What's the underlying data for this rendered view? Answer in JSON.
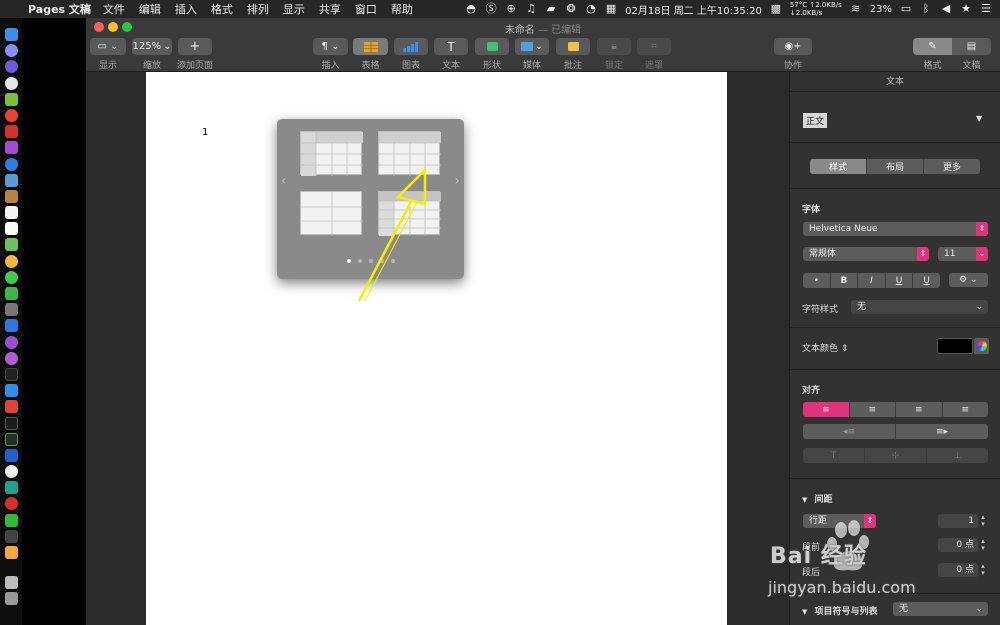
{
  "menubar": {
    "app_name": "Pages 文稿",
    "menus": [
      "文件",
      "编辑",
      "插入",
      "格式",
      "排列",
      "显示",
      "共享",
      "窗口",
      "帮助"
    ],
    "temperature": "57°C",
    "net_up": "↑2.0KB/s",
    "net_down": "↓2.0KB/s",
    "datetime": "02月18日 周二 上午10:35:20",
    "battery": "23%"
  },
  "window": {
    "title": "未命名",
    "title_suffix": "— 已编辑"
  },
  "toolbar": {
    "view_label": "显示",
    "zoom_value": "125%",
    "zoom_label": "缩放",
    "add_page_label": "添加页面",
    "insert_label": "插入",
    "table_label": "表格",
    "chart_label": "图表",
    "text_label": "文本",
    "shape_label": "形状",
    "media_label": "媒体",
    "comment_label": "批注",
    "lock_label": "锁定",
    "mask_label": "遮罩",
    "collab_label": "协作",
    "format_label": "格式",
    "document_label": "文稿"
  },
  "document": {
    "page_number": "1"
  },
  "inspector": {
    "header": "文本",
    "paragraph_style": "正文",
    "tabs": [
      "样式",
      "布局",
      "更多"
    ],
    "font_section": "字体",
    "font_name": "Helvetica Neue",
    "font_style": "常规体",
    "font_size": "11",
    "bullet_btn": "•",
    "bold_btn": "B",
    "italic_btn": "I",
    "underline_btn": "U",
    "strike_btn": "U",
    "gear_btn": "⚙",
    "char_style_label": "字符样式",
    "char_style_value": "无",
    "text_color_label": "文本颜色",
    "align_section": "对齐",
    "spacing_section": "间距",
    "line_spacing_label": "行距",
    "line_spacing_value": "1",
    "before_label": "段前",
    "before_value": "0 点",
    "after_label": "段后",
    "after_value": "0 点",
    "bullets_section": "项目符号与列表",
    "bullets_value": "无"
  },
  "watermark": {
    "text": "Bai 经验",
    "url": "jingyan.baidu.com"
  },
  "colors": {
    "accent": "#e0337a",
    "annotation_arrow": "#f5f000"
  }
}
